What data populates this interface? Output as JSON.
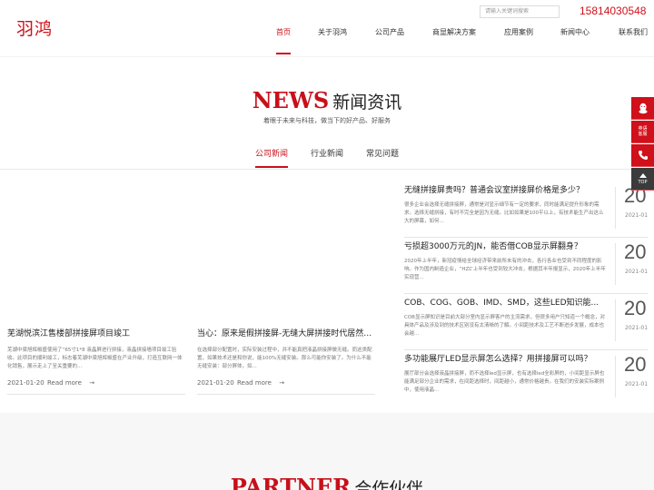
{
  "header": {
    "logo": "羽鸿",
    "search_placeholder": "请输入关键词搜索",
    "phone": "15814030548",
    "nav": [
      {
        "label": "首页",
        "active": true
      },
      {
        "label": "关于羽鸿",
        "active": false
      },
      {
        "label": "公司产品",
        "active": false
      },
      {
        "label": "商显解决方案",
        "active": false
      },
      {
        "label": "应用案例",
        "active": false
      },
      {
        "label": "新闻中心",
        "active": false
      },
      {
        "label": "联系我们",
        "active": false
      }
    ]
  },
  "news_section": {
    "title_en": "NEWS",
    "title_cn": "新闻资讯",
    "subtitle": "着眼于未来与科技，做当下的好产品、好服务",
    "tabs": [
      {
        "label": "公司新闻",
        "active": true
      },
      {
        "label": "行业新闻",
        "active": false
      },
      {
        "label": "常见问题",
        "active": false
      }
    ]
  },
  "featured": [
    {
      "title": "芜湖悦滨江售楼部拼接屏项目竣工",
      "desc": "芜湖中梁旭辉椒盛使用了“65寸1*8 液晶屏进行拼接，液晶拼接墙项目竣工验收。此项目的顺利竣工，标志着芜湖中梁旭辉椒盛在产业升级，打造互联网一体化销售，展示走上了至关重要的...",
      "date": "2021-01-20",
      "more": "Read more",
      "arrow": "→"
    },
    {
      "title": "当心：原来是假拼接屏-无缝大屏拼接时代居然是这样",
      "desc": "在选择部分配置时，实际安装过程中，并不能真把液晶拼接屏做无缝。而这类配置，如果技术还是和你说，能100%无缝安装。那么可能你安装了。为什么不能无缝安装：部分屏体，如...",
      "date": "2021-01-20",
      "more": "Read more",
      "arrow": "→"
    }
  ],
  "news_list": [
    {
      "title": "无缝拼接屏贵吗？普通会议室拼接屏价格是多少？",
      "desc": "很多企业会选择无缝拼接屏，通常是对显示细节有一定的要求，同时能满足提升形象的需求。选择无缝拼接，有时不完全是因为无缝。比如如果是100平以上，有技术能生产出这么大的屏幕，如何...",
      "day": "20",
      "month": "2021-01"
    },
    {
      "title": "亏损超3000万元的JN，能否借COB显示屏翻身？",
      "desc": "2020年上半年，新冠疫情给全球经济带来前所未有的冲击，各行各业也受到不同程度的影响。作为国内制造企业，“HZL”上半年也受到较大冲击，根据其半年报显示，2020年上半年实现营...",
      "day": "20",
      "month": "2021-01"
    },
    {
      "title": "COB、COG、GOB、IMD、SMD，这些LED知识能...",
      "desc": "COB显示屏知识是目前大部分室内显示屏客户的主流需求，但很多用户只知道一个概念，对具体产品及涉及到的技术区别没有太清晰的了解。小间距技术及工艺不断进步发展，成本也会越...",
      "day": "20",
      "month": "2021-01"
    },
    {
      "title": "多功能展厅LED显示屏怎么选择？用拼接屏可以吗？",
      "desc": "展厅部分会选择液晶拼接屏，而不选择led显示屏，也有选择led全彩屏的，小间距显示屏也能满足部分企业的需求，在间距选择时，间距越小，通常价格越贵。在我们的安装实际案例中，使用液晶...",
      "day": "20",
      "month": "2021-01"
    }
  ],
  "side_toolbar": {
    "consult_label": "英语\n客服",
    "top_label": "TOP"
  },
  "partner_section": {
    "title_en": "PARTNER",
    "title_cn": "合作伙伴"
  },
  "colors": {
    "brand_red": "#d0101a",
    "dark_button": "#3b3b3b"
  }
}
